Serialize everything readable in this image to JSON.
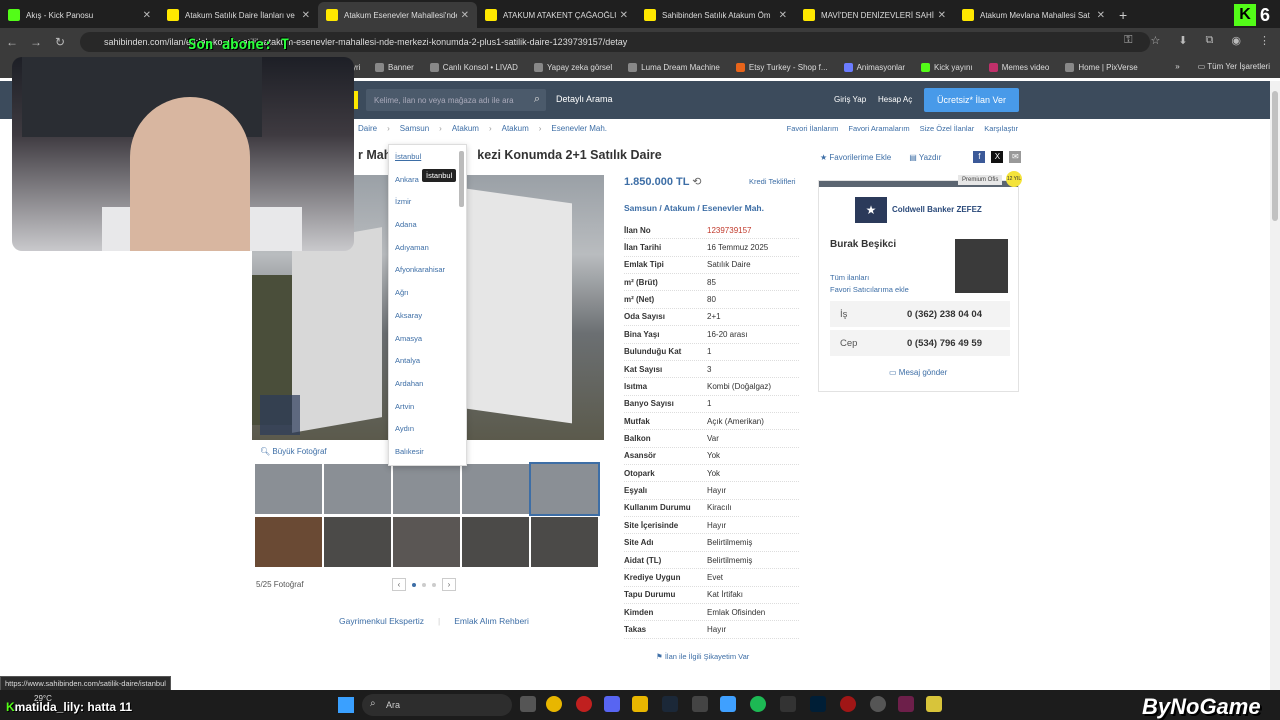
{
  "browser": {
    "tabs": [
      {
        "label": "Akış - Kick Panosu",
        "icon": "kick-icon"
      },
      {
        "label": "Atakum Satılık Daire İlanları ve",
        "icon": "sahibinden-icon"
      },
      {
        "label": "Atakum Esenevler Mahallesi'nde",
        "icon": "sahibinden-icon"
      },
      {
        "label": "ATAKUM ATAKENT ÇAĞAOĞLU",
        "icon": "sahibinden-icon"
      },
      {
        "label": "Sahibinden Satılık Atakum Öm",
        "icon": "sahibinden-icon"
      },
      {
        "label": "MAVİ'DEN DENİZEVLERİ SAHİL",
        "icon": "sahibinden-icon"
      },
      {
        "label": "Atakum Mevlana Mahallesi Sat",
        "icon": "sahibinden-icon"
      }
    ],
    "url": "sahibinden.com/ilan/emlak-konut-satilik-atakum-esenevler-mahallesi-nde-merkezi-konumda-2-plus1-satilik-daire-1239739157/detay",
    "bookmarks": [
      "Banner",
      "Canlı Konsol • LIVAD",
      "Yapay zeka görsel",
      "Luma Dream Machine",
      "Etsy Turkey - Shop f...",
      "Animasyonlar",
      "Kick yayını",
      "Memes video",
      "Home | PixVerse"
    ],
    "bookmarks_all": "Tüm Yer İşaretleri",
    "bookmark_prefix": "yri"
  },
  "overlay": {
    "last_sub": "Son abone: T",
    "chat_user": "matilda_lily",
    "chat_msg": ": hatta 11",
    "weather": "29°C",
    "brand": "ByNoGame",
    "kick_count": "6"
  },
  "site": {
    "search_placeholder": "Kelime, ilan no veya mağaza adı ile ara",
    "detailed_search": "Detaylı Arama",
    "login": "Giriş Yap",
    "signup": "Hesap Aç",
    "post_ad": "Ücretsiz* İlan Ver",
    "breadcrumbs": [
      "Daire",
      "Samsun",
      "Atakum",
      "Atakum",
      "Esenevler Mah."
    ],
    "top_links": [
      "Favori İlanlarım",
      "Favori Aramalarım",
      "Size Özel İlanlar",
      "Karşılaştır"
    ],
    "title_visible": "r Maha",
    "title_rest": "kezi Konumda 2+1 Satılık Daire",
    "add_favorites": "Favorilerime Ekle",
    "print": "Yazdır",
    "large_photo": "Büyük Fotoğraf",
    "photo_count": "5/25 Fotoğraf",
    "footer_links": [
      "Gayrimenkul Ekspertiz",
      "Emlak Alım Rehberi"
    ],
    "status_url": "https://www.sahibinden.com/satilik-daire/istanbul"
  },
  "city_dropdown": {
    "cities": [
      "İstanbul",
      "Ankara",
      "İzmir",
      "Adana",
      "Adıyaman",
      "Afyonkarahisar",
      "Ağrı",
      "Aksaray",
      "Amasya",
      "Antalya",
      "Ardahan",
      "Artvin",
      "Aydın",
      "Balıkesir"
    ],
    "tooltip": "İstanbul"
  },
  "listing": {
    "price": "1.850.000 TL",
    "credit_offers": "Kredi Teklifleri",
    "location": "Samsun  /  Atakum  /  Esenevler Mah.",
    "details": [
      {
        "key": "İlan No",
        "value": "1239739157"
      },
      {
        "key": "İlan Tarihi",
        "value": "16 Temmuz 2025"
      },
      {
        "key": "Emlak Tipi",
        "value": "Satılık Daire"
      },
      {
        "key": "m² (Brüt)",
        "value": "85"
      },
      {
        "key": "m² (Net)",
        "value": "80"
      },
      {
        "key": "Oda Sayısı",
        "value": "2+1"
      },
      {
        "key": "Bina Yaşı",
        "value": "16-20 arası"
      },
      {
        "key": "Bulunduğu Kat",
        "value": "1"
      },
      {
        "key": "Kat Sayısı",
        "value": "3"
      },
      {
        "key": "Isıtma",
        "value": "Kombi (Doğalgaz)"
      },
      {
        "key": "Banyo Sayısı",
        "value": "1"
      },
      {
        "key": "Mutfak",
        "value": "Açık (Amerikan)"
      },
      {
        "key": "Balkon",
        "value": "Var"
      },
      {
        "key": "Asansör",
        "value": "Yok"
      },
      {
        "key": "Otopark",
        "value": "Yok"
      },
      {
        "key": "Eşyalı",
        "value": "Hayır"
      },
      {
        "key": "Kullanım Durumu",
        "value": "Kiracılı"
      },
      {
        "key": "Site İçerisinde",
        "value": "Hayır"
      },
      {
        "key": "Site Adı",
        "value": "Belirtilmemiş"
      },
      {
        "key": "Aidat (TL)",
        "value": "Belirtilmemiş"
      },
      {
        "key": "Krediye Uygun",
        "value": "Evet"
      },
      {
        "key": "Tapu Durumu",
        "value": "Kat İrtifakı"
      },
      {
        "key": "Kimden",
        "value": "Emlak Ofisinden"
      },
      {
        "key": "Takas",
        "value": "Hayır"
      }
    ],
    "complaint": "İlan ile İlgili Şikayetim Var"
  },
  "seller": {
    "premium": "Premium Ofis",
    "badge": "12 YIL",
    "agency": "Coldwell Banker ZEFEZ",
    "agent": "Burak Beşikci",
    "all_listings": "Tüm ilanları",
    "add_fav_seller": "Favori Satıcılarıma ekle",
    "phones": [
      {
        "label": "İş",
        "number": "0 (362) 238 04 04"
      },
      {
        "label": "Cep",
        "number": "0 (534) 796 49 59"
      }
    ],
    "send_message": "Mesaj gönder"
  },
  "taskbar": {
    "search": "Ara"
  },
  "colors": {
    "link": "#3d6ea6",
    "header": "#3c4b5c",
    "post_button": "#489ae9",
    "kick": "#53fc18",
    "sahibinden": "#ffe800"
  }
}
